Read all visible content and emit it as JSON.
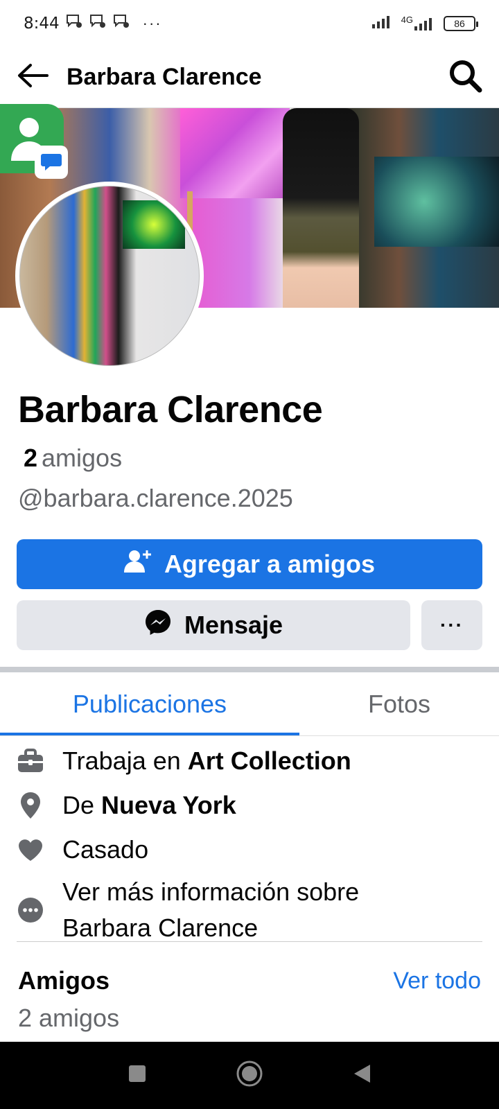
{
  "status_bar": {
    "time": "8:44",
    "dots": "···",
    "network": "4G",
    "battery": "86"
  },
  "app_bar": {
    "title": "Barbara Clarence"
  },
  "profile": {
    "name": "Barbara Clarence",
    "friends_number": "2",
    "friends_word": "amigos",
    "username": "@barbara.clarence.2025"
  },
  "actions": {
    "add_friend_label": "Agregar a amigos",
    "message_label": "Mensaje",
    "more_label": "···"
  },
  "tabs": [
    {
      "label": "Publicaciones",
      "active": true
    },
    {
      "label": "Fotos",
      "active": false
    }
  ],
  "intro": {
    "work_prefix": "Trabaja en ",
    "work_place": "Art Collection",
    "from_prefix": "De ",
    "from_place": "Nueva York",
    "relationship": "Casado",
    "more_info_line1": "Ver más información sobre",
    "more_info_line2": "Barbara Clarence"
  },
  "friends_section": {
    "title": "Amigos",
    "see_all": "Ver todo",
    "count": "2 amigos"
  },
  "colors": {
    "accent": "#1b74e4",
    "secondary_button": "#e4e6eb",
    "muted_text": "#65676b"
  }
}
